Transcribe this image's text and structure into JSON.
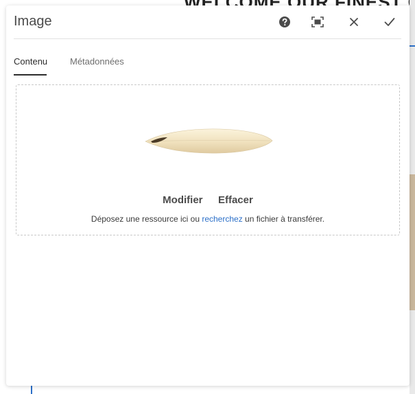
{
  "background": {
    "heading": "WELCOME OUR FINEST C"
  },
  "dialog": {
    "title": "Image",
    "buttons": {
      "help": "help-icon",
      "fullscreen": "fullscreen-icon",
      "close": "close-icon",
      "done": "checkmark-icon"
    }
  },
  "tabs": [
    {
      "label": "Contenu",
      "selected": true
    },
    {
      "label": "Métadonnées",
      "selected": false
    }
  ],
  "dropzone": {
    "modify_label": "Modifier",
    "clear_label": "Effacer",
    "hint_before": "Déposez une ressource ici ou ",
    "hint_link": "recherchez",
    "hint_after": " un fichier à transférer."
  },
  "colors": {
    "link": "#2b6fc8",
    "text": "#4b4b4b",
    "tab_underline": "#2c2c2c"
  }
}
